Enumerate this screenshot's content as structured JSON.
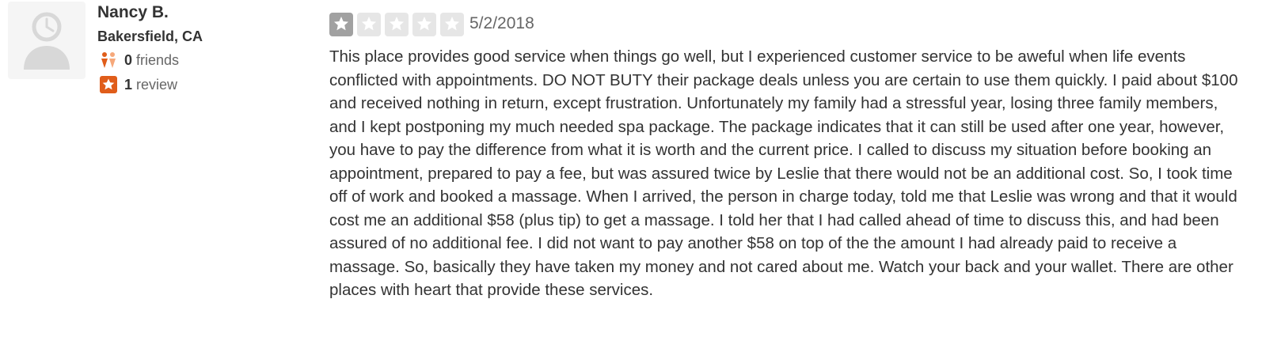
{
  "user": {
    "name": "Nancy B.",
    "location": "Bakersfield, CA",
    "friends_count": "0",
    "friends_label": "friends",
    "reviews_count": "1",
    "reviews_label": "review",
    "avatar_icon": "default-avatar-icon",
    "friends_icon": "friends-icon",
    "review_icon": "review-star-icon"
  },
  "review": {
    "rating": 1,
    "max_rating": 5,
    "date": "5/2/2018",
    "text": "This place provides good service when things go well, but I experienced customer service to be aweful when life events conflicted with appointments.  DO NOT BUTY their package deals unless you are certain to use them quickly.  I paid about $100 and received nothing in return, except frustration.  Unfortunately my family had a stressful year, losing three family members, and I kept postponing my much needed spa package.  The package indicates that it can still be used after one year, however, you have to pay the difference from what it is worth and the current price.  I called to discuss my situation before booking an appointment, prepared to pay a fee, but was assured twice by Leslie that there would not be an additional cost.  So, I took time off of work and booked a massage.  When I arrived, the person in charge today, told me that Leslie was wrong and that it would cost me an additional $58 (plus tip) to get a massage.  I told her that I had called ahead of time to discuss this, and had been assured of no additional fee.  I did not want to pay another $58 on top of the the amount I had already paid to receive a massage.  So, basically they have taken my money and not cared about me.   Watch your back and your wallet.  There are other places with heart that provide these services."
  },
  "colors": {
    "star_filled": "#a1a1a1",
    "star_empty": "#e6e6e6",
    "accent_orange": "#e05d1a",
    "friends_orange": "#f18d4f",
    "text": "#333333",
    "muted": "#666666"
  }
}
